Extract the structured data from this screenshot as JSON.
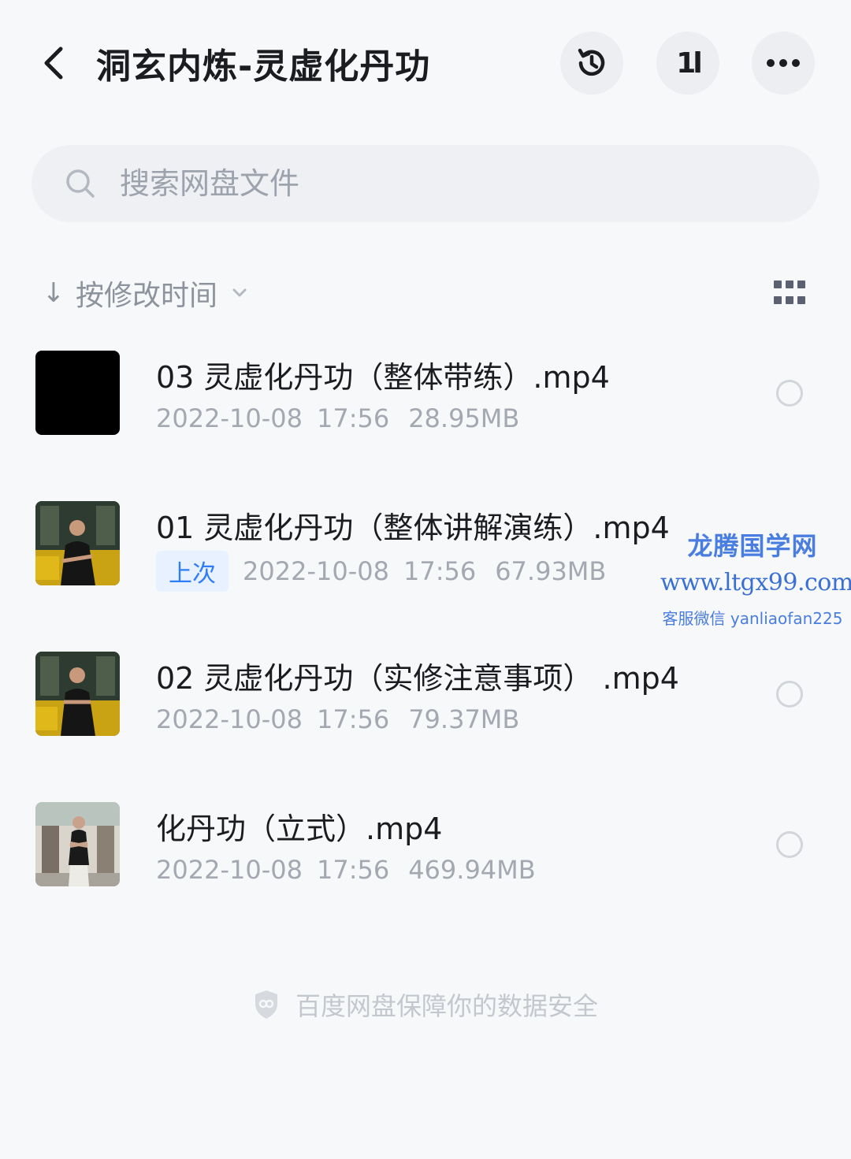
{
  "header": {
    "title": "洞玄内炼-灵虚化丹功",
    "back_icon": "chevron-left-icon",
    "history_icon": "history-icon",
    "sort_icon": "sort-swap-icon",
    "sort_glyph": "1l",
    "more_icon": "more-horizontal-icon"
  },
  "search": {
    "placeholder": "搜索网盘文件",
    "value": ""
  },
  "sort": {
    "label": "按修改时间",
    "direction_glyph": "↓"
  },
  "files": [
    {
      "name": "03 灵虚化丹功（整体带练）.mp4",
      "date": "2022-10-08",
      "time": "17:56",
      "size": "28.95MB",
      "badge": "",
      "thumb": "black-thumbnail"
    },
    {
      "name": "01 灵虚化丹功（整体讲解演练）.mp4",
      "date": "2022-10-08",
      "time": "17:56",
      "size": "67.93MB",
      "badge": "上次",
      "thumb": "video-thumbnail-seated"
    },
    {
      "name": "02 灵虚化丹功（实修注意事项） .mp4",
      "date": "2022-10-08",
      "time": "17:56",
      "size": "79.37MB",
      "badge": "",
      "thumb": "video-thumbnail-seated"
    },
    {
      "name": "化丹功（立式）.mp4",
      "date": "2022-10-08",
      "time": "17:56",
      "size": "469.94MB",
      "badge": "",
      "thumb": "video-thumbnail-standing"
    }
  ],
  "watermark": {
    "title": "龙腾国学网",
    "url": "www.ltgx99.com",
    "contact": "客服微信 yanliaofan225"
  },
  "footer": {
    "text": "百度网盘保障你的数据安全",
    "icon": "shield-icon"
  },
  "colors": {
    "accent": "#2f7df6",
    "meta_text": "#a3a8b1",
    "background": "#f7f8fa"
  }
}
